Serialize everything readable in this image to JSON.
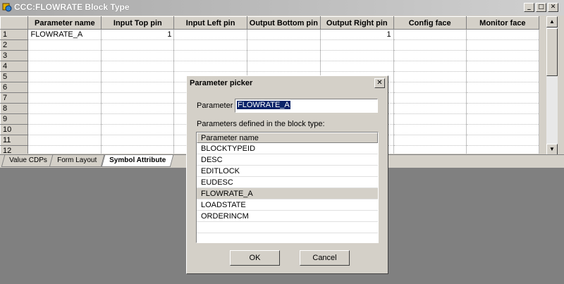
{
  "window": {
    "title": "CCC:FLOWRATE Block Type",
    "minimize": "_",
    "maximize": "□",
    "close": "✕"
  },
  "grid": {
    "columns": [
      "Parameter name",
      "Input Top pin",
      "Input Left pin",
      "Output Bottom pin",
      "Output Right pin",
      "Config face",
      "Monitor face"
    ],
    "rows": [
      {
        "num": "1",
        "cells": [
          "FLOWRATE_A",
          "1",
          "",
          "",
          "1",
          "",
          ""
        ]
      },
      {
        "num": "2",
        "cells": [
          "",
          "",
          "",
          "",
          "",
          "",
          ""
        ]
      },
      {
        "num": "3",
        "cells": [
          "",
          "",
          "",
          "",
          "",
          "",
          ""
        ]
      },
      {
        "num": "4",
        "cells": [
          "",
          "",
          "",
          "",
          "",
          "",
          ""
        ]
      },
      {
        "num": "5",
        "cells": [
          "",
          "",
          "",
          "",
          "",
          "",
          ""
        ]
      },
      {
        "num": "6",
        "cells": [
          "",
          "",
          "",
          "",
          "",
          "",
          ""
        ]
      },
      {
        "num": "7",
        "cells": [
          "",
          "",
          "",
          "",
          "",
          "",
          ""
        ]
      },
      {
        "num": "8",
        "cells": [
          "",
          "",
          "",
          "",
          "",
          "",
          ""
        ]
      },
      {
        "num": "9",
        "cells": [
          "",
          "",
          "",
          "",
          "",
          "",
          ""
        ]
      },
      {
        "num": "10",
        "cells": [
          "",
          "",
          "",
          "",
          "",
          "",
          ""
        ]
      },
      {
        "num": "11",
        "cells": [
          "",
          "",
          "",
          "",
          "",
          "",
          ""
        ]
      },
      {
        "num": "12",
        "cells": [
          "",
          "",
          "",
          "",
          "",
          "",
          ""
        ]
      }
    ]
  },
  "tabs": [
    {
      "label": "Value CDPs",
      "active": false
    },
    {
      "label": "Form Layout",
      "active": false
    },
    {
      "label": "Symbol Attribute",
      "active": true
    }
  ],
  "dialog": {
    "title": "Parameter picker",
    "close": "✕",
    "parameter_label": "Parameter",
    "parameter_value": "FLOWRATE_A",
    "list_caption": "Parameters defined in the block type:",
    "list_header": "Parameter name",
    "items": [
      "BLOCKTYPEID",
      "DESC",
      "EDITLOCK",
      "EUDESC",
      "FLOWRATE_A",
      "LOADSTATE",
      "ORDERINCM"
    ],
    "selected_item": "FLOWRATE_A",
    "ok_label": "OK",
    "cancel_label": "Cancel"
  }
}
